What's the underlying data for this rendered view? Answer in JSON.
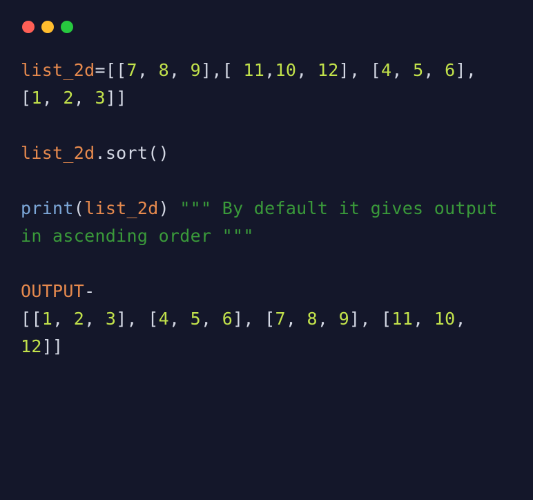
{
  "line1": {
    "var": "list_2d",
    "eq": "=",
    "seg1": "[[",
    "n1": "7",
    "c1": ", ",
    "n2": "8",
    "c2": ", ",
    "n3": "9",
    "seg2": "],[ ",
    "n4": "11",
    "c3": ",",
    "n5": "10",
    "c4": ", ",
    "n6": "12",
    "seg3": "], [",
    "n7": "4",
    "c5": ", ",
    "n8": "5",
    "c6": ", ",
    "n9": "6",
    "seg4": "], [",
    "n10": "1",
    "c7": ", ",
    "n11": "2",
    "c8": ", ",
    "n12": "3",
    "seg5": "]]"
  },
  "line2": {
    "var": "list_2d",
    "dot": ".",
    "method": "sort",
    "parens": "()"
  },
  "line3": {
    "func": "print",
    "open": "(",
    "var": "list_2d",
    "close": ")",
    "space": " ",
    "str": "\"\"\" By default it gives output in ascending order \"\"\""
  },
  "output": {
    "label": "OUTPUT",
    "dash": "-",
    "text1": "[[",
    "on1": "1",
    "oc1": ", ",
    "on2": "2",
    "oc2": ", ",
    "on3": "3",
    "text2": "], [",
    "on4": "4",
    "oc3": ", ",
    "on5": "5",
    "oc4": ", ",
    "on6": "6",
    "text3": "], [",
    "on7": "7",
    "oc5": ", ",
    "on8": "8",
    "oc6": ", ",
    "on9": "9",
    "text4": "], [",
    "on10": "11",
    "oc7": ", ",
    "on11": "10",
    "oc8": ", ",
    "on12": "12",
    "text5": "]]"
  }
}
